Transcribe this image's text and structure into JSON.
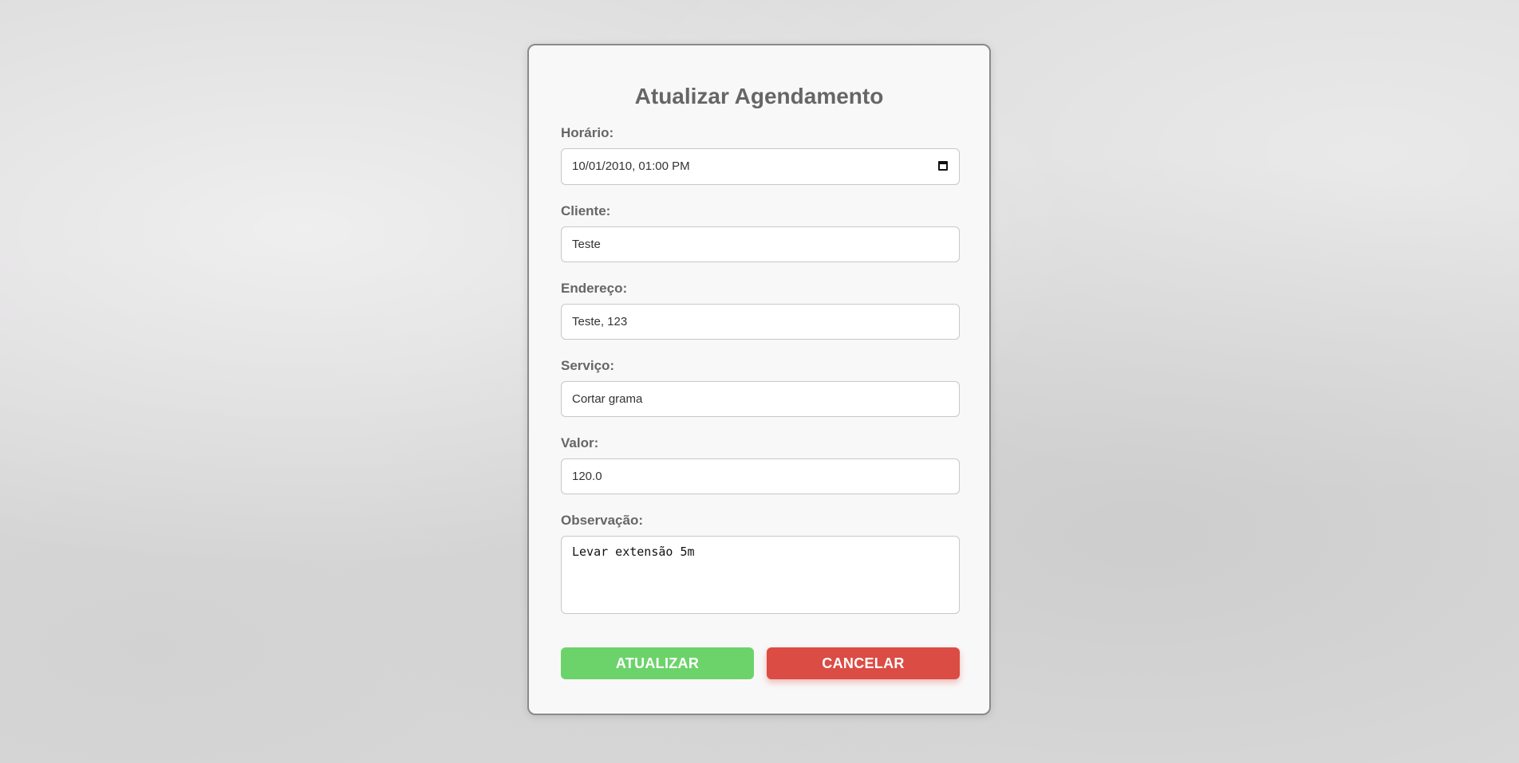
{
  "form": {
    "title": "Atualizar Agendamento",
    "fields": {
      "horario": {
        "label": "Horário:",
        "value": "10/01/2010, 01:00 PM"
      },
      "cliente": {
        "label": "Cliente:",
        "value": "Teste"
      },
      "endereco": {
        "label": "Endereço:",
        "value": "Teste, 123"
      },
      "servico": {
        "label": "Serviço:",
        "value": "Cortar grama"
      },
      "valor": {
        "label": "Valor:",
        "value": "120.0"
      },
      "observacao": {
        "label": "Observação:",
        "value": "Levar extensão 5m"
      }
    },
    "buttons": {
      "update_label": "ATUALIZAR",
      "cancel_label": "CANCELAR"
    }
  },
  "icons": {
    "datetime": "calendar-icon"
  },
  "colors": {
    "update_button": "#6cd36b",
    "cancel_button": "#db4c44",
    "title_text": "#666666"
  }
}
